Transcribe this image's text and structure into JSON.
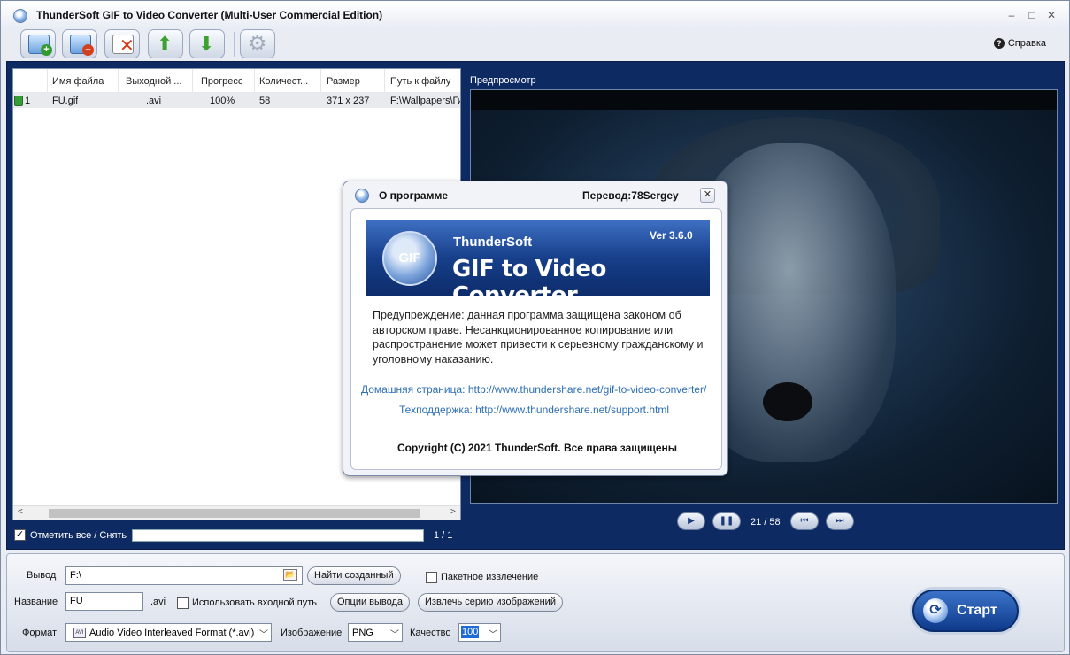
{
  "window": {
    "title": "ThunderSoft GIF to Video Converter (Multi-User Commercial Edition)",
    "controls": [
      "–",
      "□",
      "✕"
    ]
  },
  "toolbar": {
    "buttons": [
      "add-file",
      "remove-file",
      "clear-list",
      "move-up",
      "move-down",
      "settings"
    ],
    "help_label": "Справка"
  },
  "file_list": {
    "columns": [
      "Имя файла",
      "Выходной ...",
      "Прогресс",
      "Количест...",
      "Размер",
      "Путь к файлу"
    ],
    "rows": [
      {
        "index": "1",
        "name": "FU.gif",
        "output": ".avi",
        "progress": "100%",
        "count": "58",
        "size": "371 x 237",
        "path": "F:\\Wallpapers\\Ги"
      }
    ],
    "check_all_label": "Отметить все / Снять",
    "check_all_checked": true,
    "counter": "1 / 1"
  },
  "preview": {
    "label": "Предпросмотр",
    "frame_counter": "21 / 58"
  },
  "output": {
    "output_label": "Вывод",
    "output_value": "F:\\",
    "find_created_label": "Найти созданный",
    "batch_extract_label": "Пакетное извлечение",
    "batch_extract_checked": false,
    "name_label": "Название",
    "name_value": "FU",
    "name_ext": ".avi",
    "use_input_path_label": "Использовать входной путь",
    "use_input_path_checked": false,
    "output_options_label": "Опции вывода",
    "extract_series_label": "Извлечь серию изображений",
    "format_label": "Формат",
    "format_value": "Audio Video Interleaved Format (*.avi)",
    "image_label": "Изображение",
    "image_value": "PNG",
    "quality_label": "Качество",
    "quality_value": "100",
    "start_label": "Старт"
  },
  "about_dialog": {
    "title": "О программе",
    "translator": "Перевод:78Sergey",
    "banner_brand": "ThunderSoft",
    "banner_product": "GIF to Video Converter",
    "banner_logo": "GIF",
    "version": "Ver 3.6.0",
    "warning": "Предупреждение: данная программа защищена законом об авторском праве. Несанкционированное копирование или распространение может привести к серьезному гражданскому и уголовному наказанию.",
    "homepage": "Домашняя страница: http://www.thundershare.net/gif-to-video-converter/",
    "support": "Техподдержка: http://www.thundershare.net/support.html",
    "copyright": "Copyright (C) 2021 ThunderSoft. Все права защищены"
  }
}
